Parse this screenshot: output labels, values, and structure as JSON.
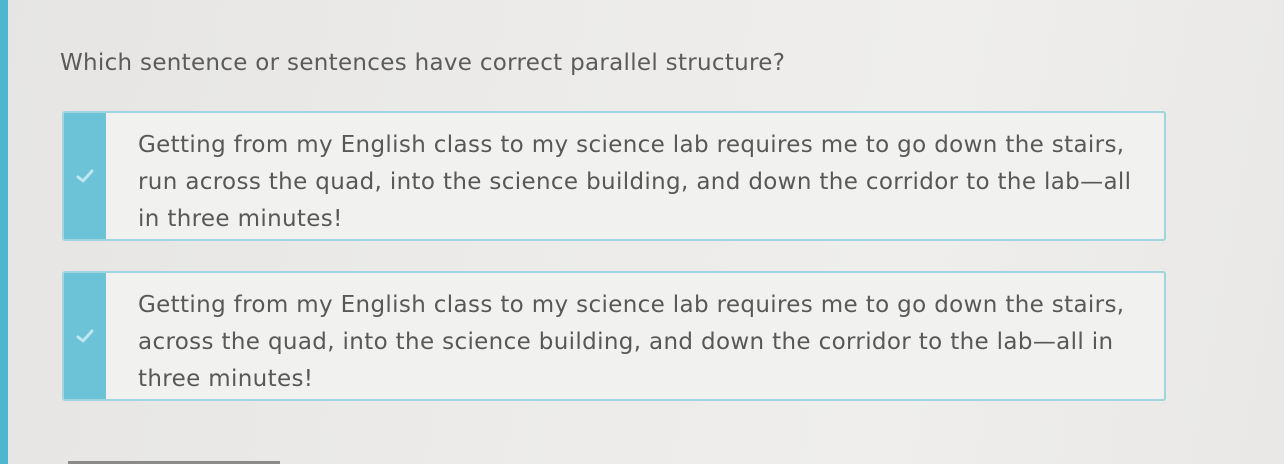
{
  "question": {
    "text": "Which sentence or sentences have correct parallel structure?"
  },
  "choices": [
    {
      "text": "Getting from my English class to my science lab requires me to go down the stairs, run across the quad, into the science building, and down the corridor to the lab—all in three minutes!",
      "selected": true
    },
    {
      "text": "Getting from my English class to my science lab requires me to go down the stairs, across the quad, into the science building, and down the corridor to the lab—all in three minutes!",
      "selected": true
    }
  ],
  "colors": {
    "accent": "#4fb6cf",
    "check_bar": "#6cc3d7",
    "choice_border": "#9fd5df",
    "text": "#5a5a5a"
  },
  "icons": {
    "check": "checkmark-icon"
  }
}
